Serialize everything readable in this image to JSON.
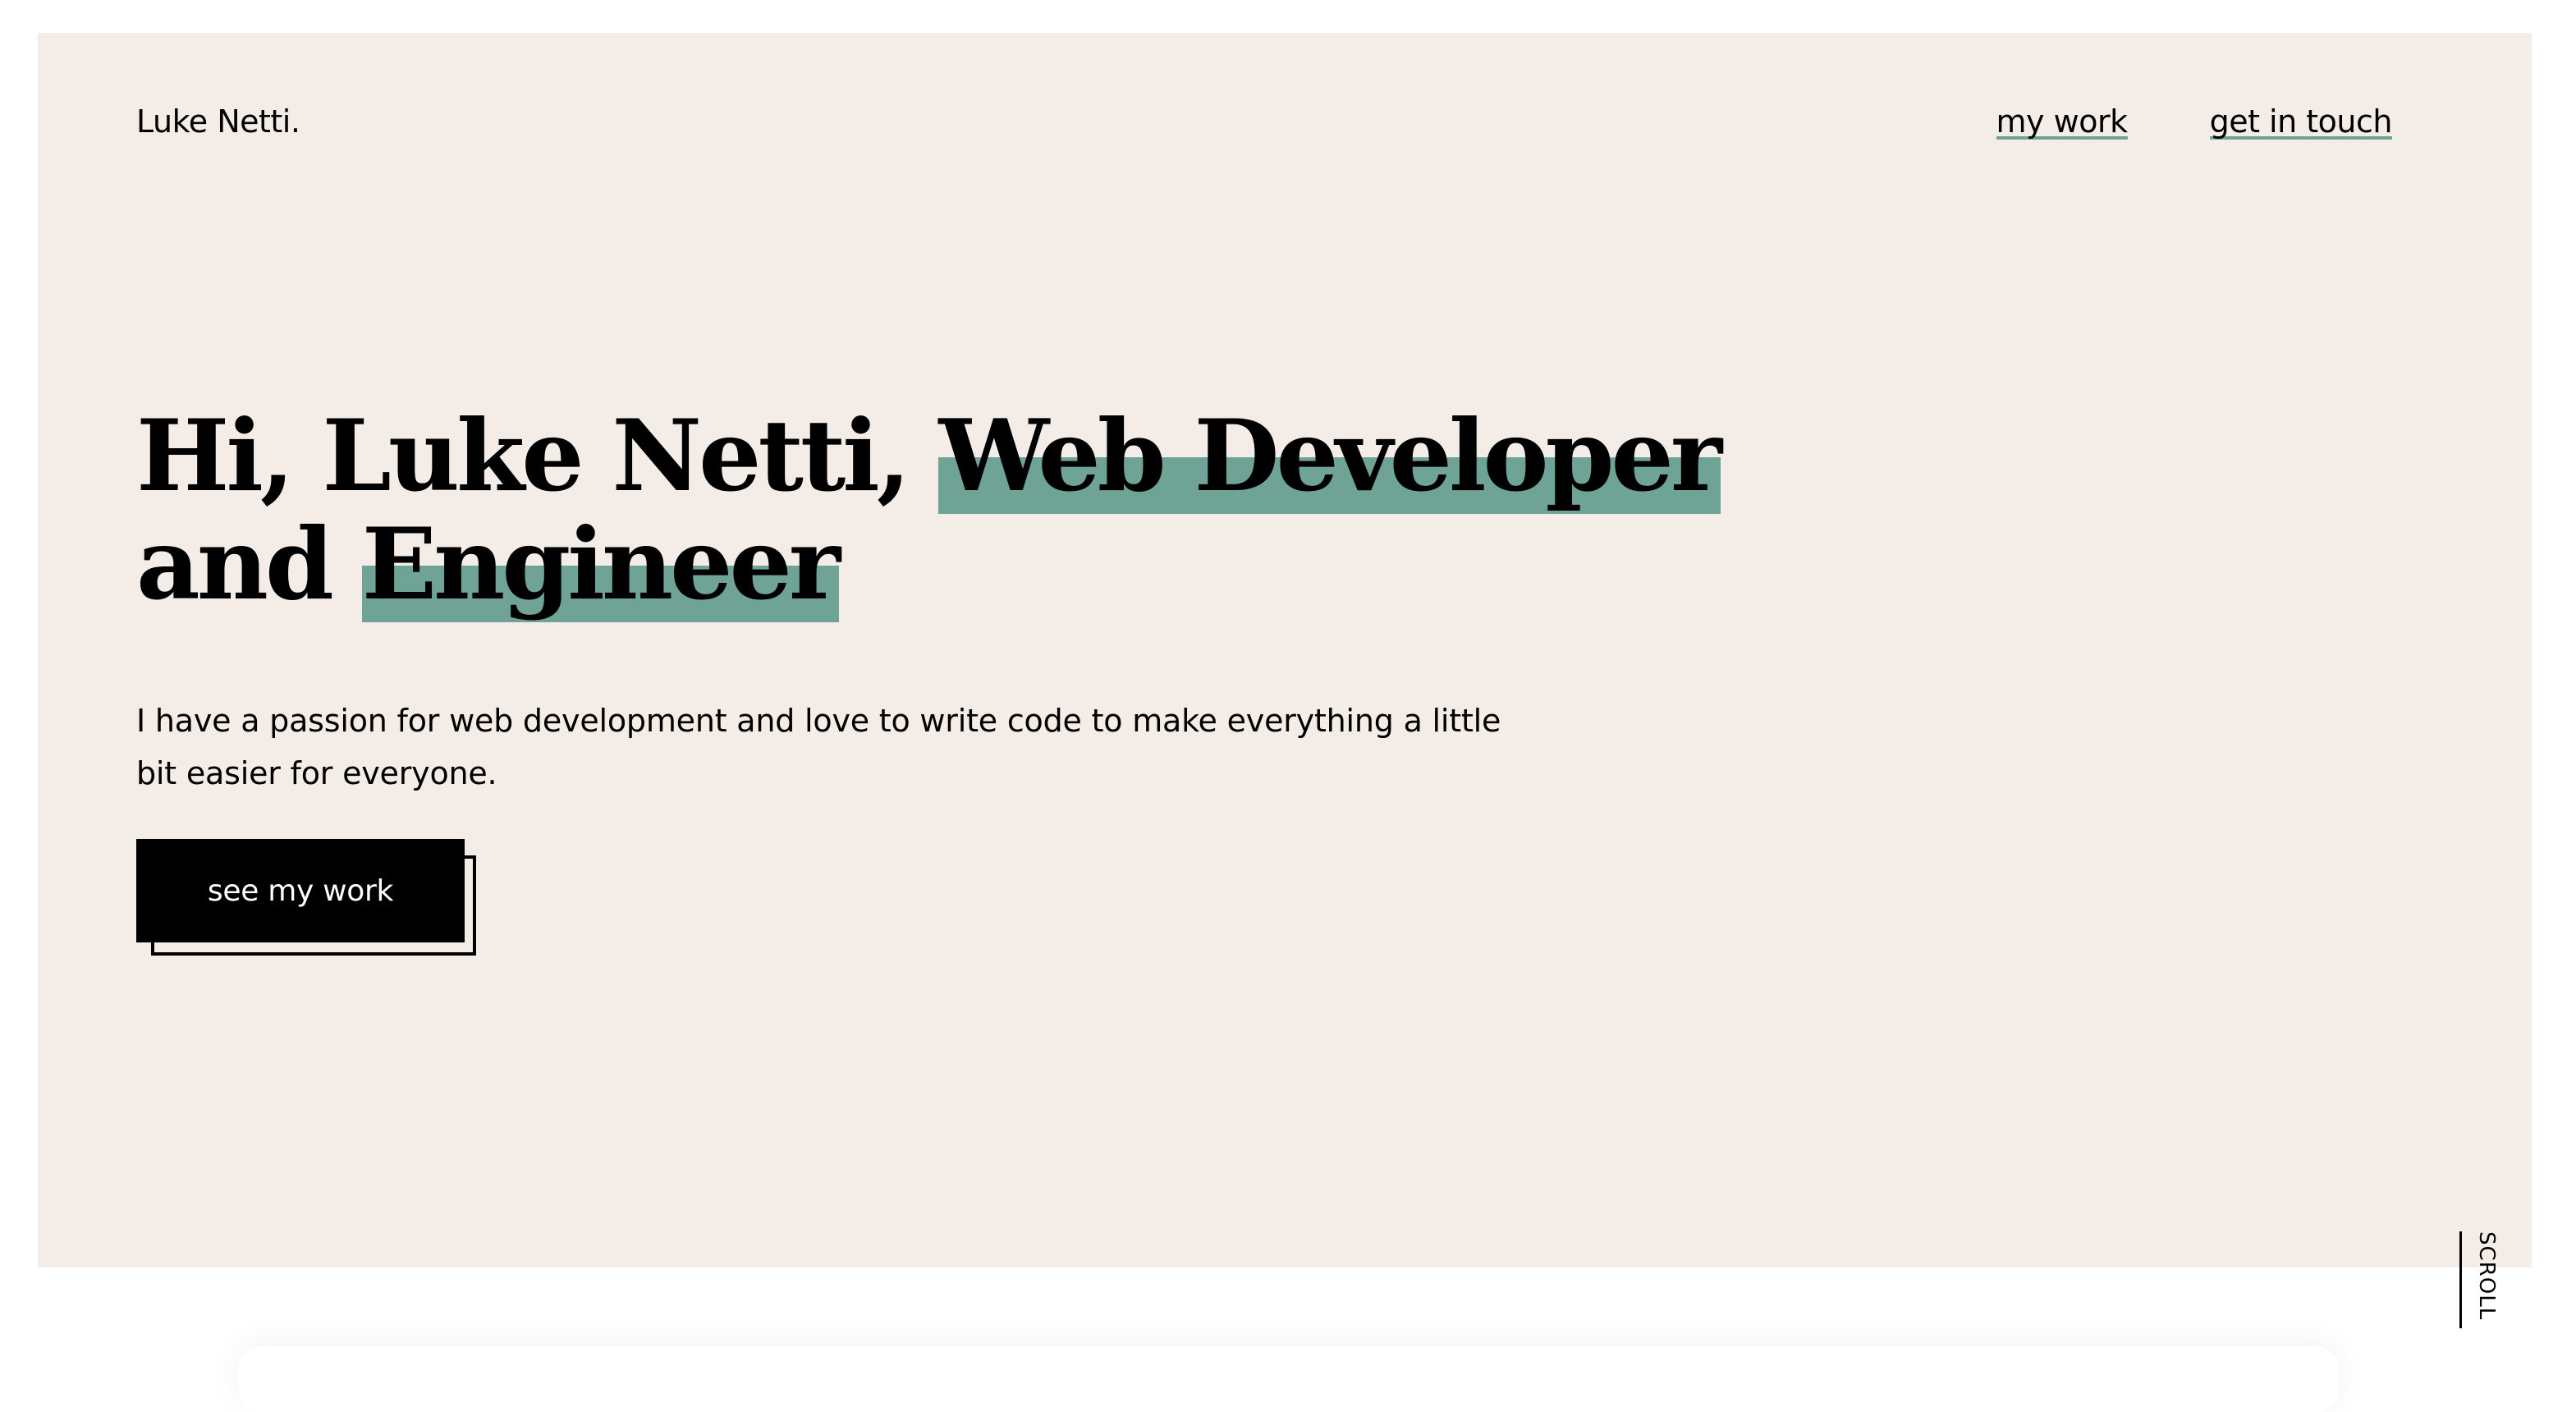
{
  "header": {
    "logo": "Luke Netti.",
    "nav": [
      {
        "label": "my work"
      },
      {
        "label": "get in touch"
      }
    ]
  },
  "hero": {
    "headline": {
      "part1": "Hi, Luke Netti,",
      "highlight1": "Web Developer",
      "part2": "and",
      "highlight2": "Engineer"
    },
    "intro": "I have a passion for web development and love to write code to make everything a little bit easier for everyone.",
    "cta_label": "see my work",
    "scroll_label": "SCROLL"
  },
  "colors": {
    "hero_background": "#f4ede7",
    "accent": "#6fa396",
    "text": "#000000"
  }
}
